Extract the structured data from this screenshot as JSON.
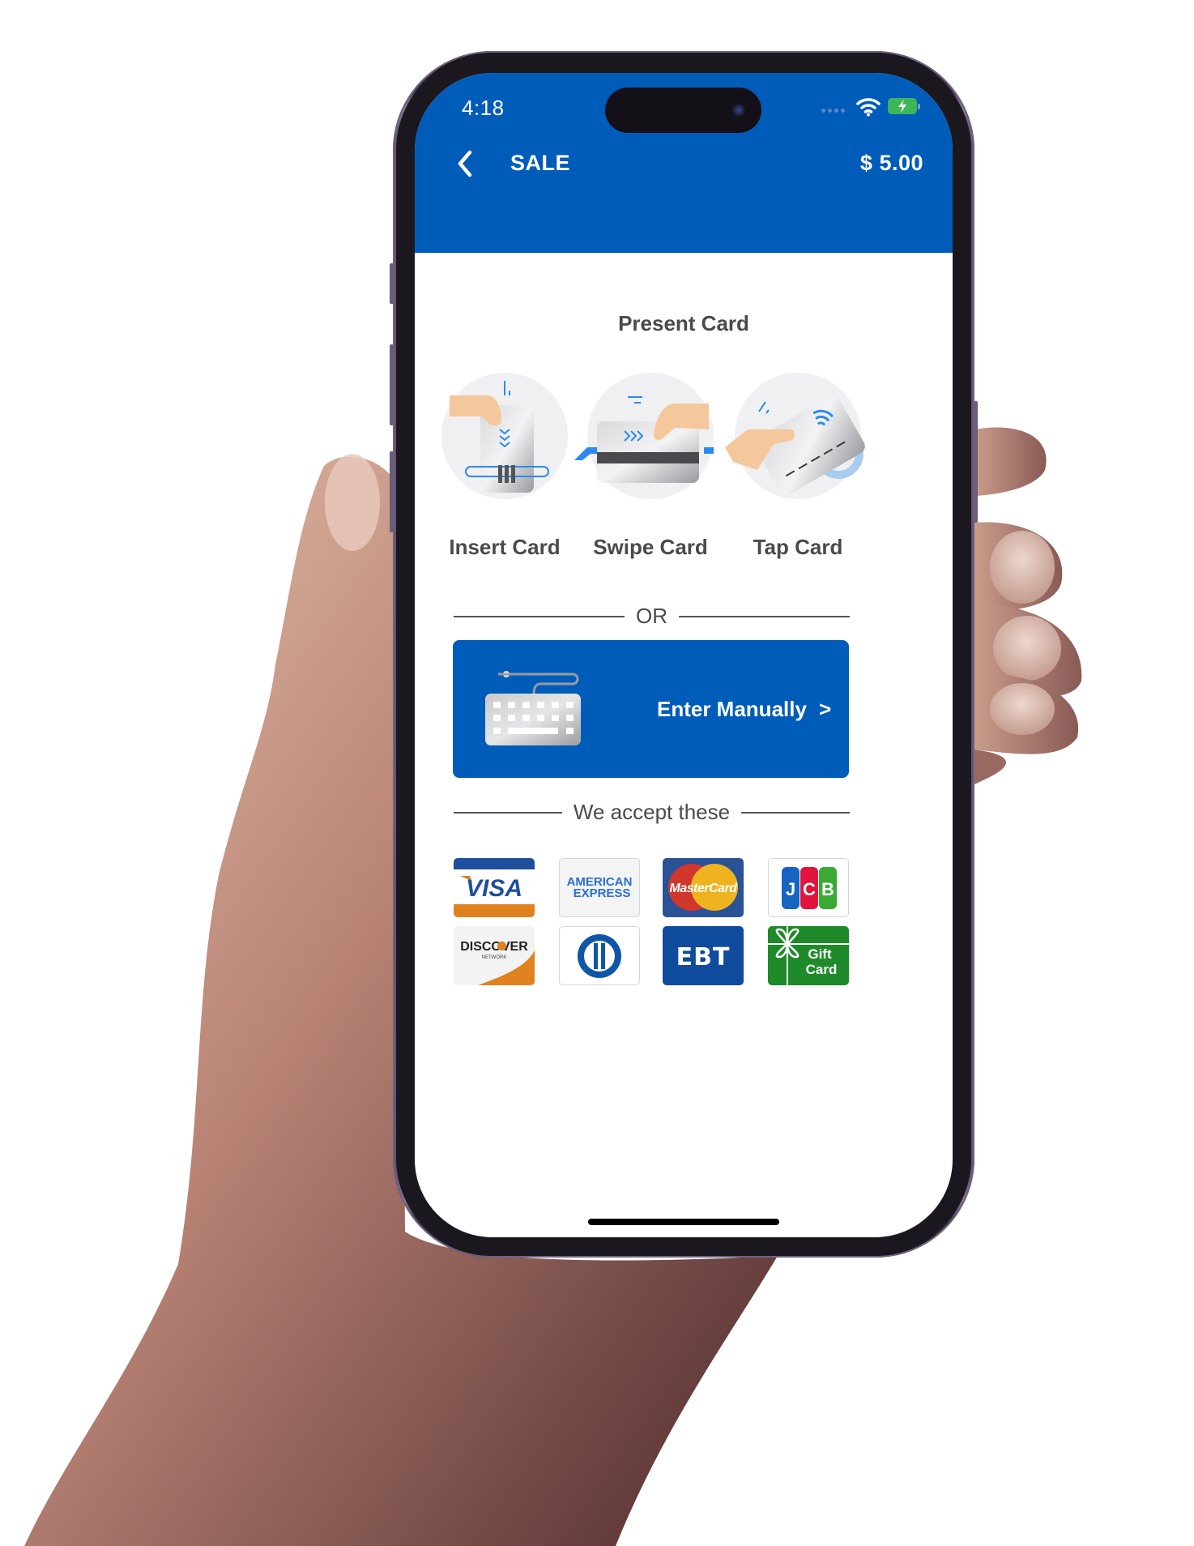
{
  "status_bar": {
    "time": "4:18",
    "icons": [
      "cellular-dots-icon",
      "wifi-icon",
      "battery-charging-icon"
    ]
  },
  "nav": {
    "back_icon": "chevron-left-icon",
    "title": "SALE",
    "amount": "$ 5.00"
  },
  "present_card": {
    "title": "Present Card",
    "methods": [
      {
        "label": "Insert Card",
        "icon": "insert-card-icon"
      },
      {
        "label": "Swipe Card",
        "icon": "swipe-card-icon"
      },
      {
        "label": "Tap Card",
        "icon": "tap-card-icon"
      }
    ]
  },
  "or_divider": "OR",
  "manual_entry": {
    "label": "Enter Manually",
    "chevron": ">",
    "icon": "keyboard-icon"
  },
  "accepted": {
    "title": "We accept these",
    "cards": [
      {
        "name": "Visa",
        "text": "VISA"
      },
      {
        "name": "American Express",
        "text_line1": "AMERICAN",
        "text_line2": "EXPRESS"
      },
      {
        "name": "MasterCard",
        "text": "MasterCard"
      },
      {
        "name": "JCB",
        "text": "JCB"
      },
      {
        "name": "Discover",
        "text": "DISCOVER",
        "subtext": "NETWORK"
      },
      {
        "name": "Diners Club",
        "text": ""
      },
      {
        "name": "EBT",
        "text": "EBT"
      },
      {
        "name": "Gift Card",
        "text_line1": "Gift",
        "text_line2": "Card"
      }
    ]
  },
  "colors": {
    "brand_blue": "#005cb9",
    "text_gray": "#4a4a4a",
    "visa_blue": "#1a4d9c",
    "visa_orange": "#e0821e",
    "amex_blue": "#2a6fd6",
    "mastercard_red": "#d0362a",
    "mastercard_yellow": "#f0b320",
    "ebt_blue": "#0f4c9e",
    "gift_green": "#1f8a2a"
  }
}
